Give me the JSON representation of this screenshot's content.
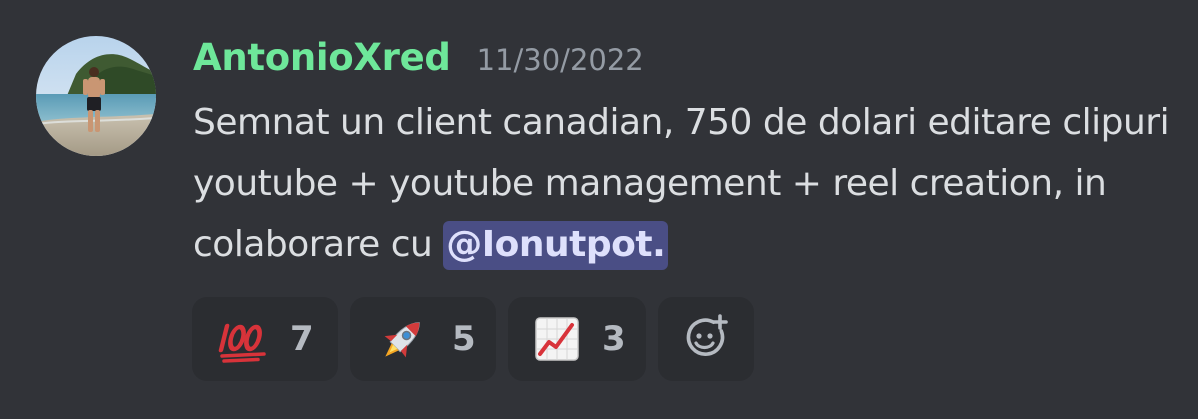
{
  "message": {
    "username": "AntonioXred",
    "username_color": "#6ee79a",
    "timestamp": "11/30/2022",
    "content_text": "Semnat un client canadian, 750 de dolari editare clipuri youtube + youtube management + reel creation, in colaborare cu ",
    "mention": "@Ionutpot.",
    "avatar_icon": "user-avatar-beach-photo"
  },
  "reactions": [
    {
      "emoji": "hundred-points",
      "count": "7"
    },
    {
      "emoji": "rocket",
      "count": "5"
    },
    {
      "emoji": "chart-increasing",
      "count": "3"
    }
  ],
  "add_reaction_icon": "add-reaction-smiley-plus-icon",
  "colors": {
    "background": "#313338",
    "reaction_bg": "#2b2d31",
    "mention_bg": "#4a4e85",
    "mention_text": "#dee0fc",
    "text": "#dbdee1",
    "muted": "#949ba4"
  }
}
